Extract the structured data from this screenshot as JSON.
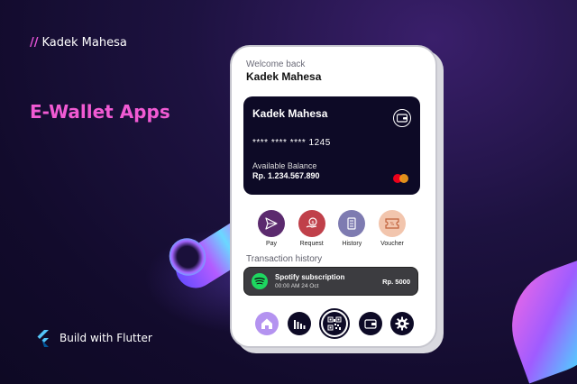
{
  "author": {
    "slash": "//",
    "name": "Kadek Mahesa"
  },
  "title": "E-Wallet Apps",
  "footer": {
    "text": "Build with Flutter",
    "icon": "flutter-icon"
  },
  "phone": {
    "welcome": "Welcome back",
    "user_name": "Kadek Mahesa",
    "card": {
      "holder": "Kadek Mahesa",
      "number": "**** **** **** 1245",
      "balance_label": "Available Balance",
      "balance_value": "Rp. 1.234.567.890",
      "icon": "wallet-icon",
      "brand_icon": "mastercard-icon"
    },
    "actions": [
      {
        "label": "Pay",
        "icon": "send-icon",
        "color": "#5b2a6e"
      },
      {
        "label": "Request",
        "icon": "money-request-icon",
        "color": "#c0404a"
      },
      {
        "label": "History",
        "icon": "receipt-icon",
        "color": "#7e7bb1"
      },
      {
        "label": "Voucher",
        "icon": "ticket-icon",
        "color": "#f2c5ad"
      }
    ],
    "transaction_history_label": "Transaction history",
    "transactions": [
      {
        "title": "Spotify subscription",
        "date": "00:00 AM 24 Oct",
        "amount": "Rp. 5000",
        "icon": "spotify-icon"
      }
    ],
    "nav": [
      {
        "name": "home",
        "icon": "home-icon",
        "active": true
      },
      {
        "name": "stats",
        "icon": "bar-chart-icon",
        "active": false
      },
      {
        "name": "scan",
        "icon": "qr-code-icon",
        "active": false
      },
      {
        "name": "wallet",
        "icon": "wallet-icon",
        "active": false
      },
      {
        "name": "settings",
        "icon": "gear-icon",
        "active": false
      }
    ]
  },
  "colors": {
    "accent": "#f15ad3",
    "card_bg": "#0d0a26",
    "home_active": "#b493f0",
    "spotify": "#1ed760"
  }
}
